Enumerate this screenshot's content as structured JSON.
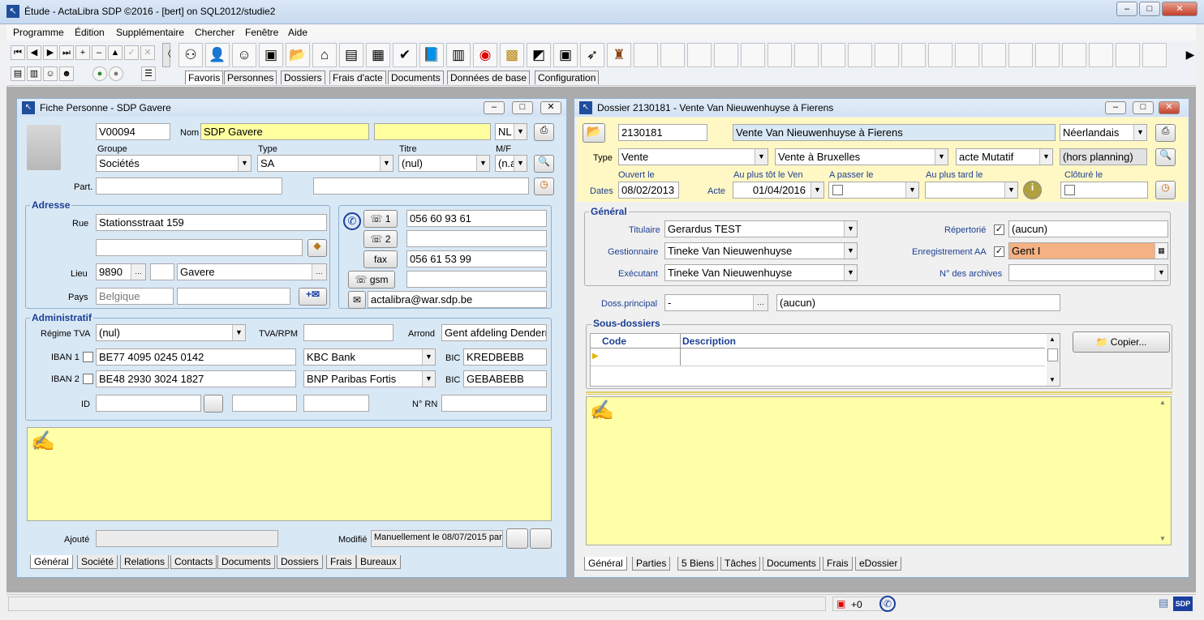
{
  "window": {
    "title": "Étude  - ActaLibra  SDP ©2016 - [bert]  on  SQL2012/studie2"
  },
  "menu": [
    "Programme",
    "Édition",
    "Supplémentaire",
    "Chercher",
    "Fenêtre",
    "Aide"
  ],
  "toolbar_tabs": [
    "Favoris",
    "Personnes",
    "Dossiers",
    "Frais d'acte",
    "Documents",
    "Données de base",
    "Configuration"
  ],
  "person": {
    "title": "Fiche Personne - SDP Gavere",
    "id": "V00094",
    "nom_label": "Nom",
    "nom": "SDP Gavere",
    "lang": "NL",
    "groupe_label": "Groupe",
    "groupe": "Sociétés",
    "type_label": "Type",
    "type": "SA",
    "titre_label": "Titre",
    "titre": "(nul)",
    "mf_label": "M/F",
    "mf": "(n.a",
    "part_label": "Part.",
    "adresse_label": "Adresse",
    "rue_label": "Rue",
    "rue": "Stationsstraat 159",
    "lieu_label": "Lieu",
    "postcode": "9890",
    "lieu": "Gavere",
    "pays_label": "Pays",
    "pays": "Belgique",
    "phone1_label": "1",
    "phone1": "056 60 93 61",
    "phone2_label": "2",
    "fax_label": "fax",
    "fax": "056 61 53 99",
    "gsm_label": "gsm",
    "email": "actalibra@war.sdp.be",
    "admin_label": "Administratif",
    "regime_label": "Régime TVA",
    "regime": "(nul)",
    "tva_label": "TVA/RPM",
    "arrond_label": "Arrond",
    "arrond": "Gent afdeling Denderr",
    "iban1_label": "IBAN 1",
    "iban1": "BE77 4095 0245 0142",
    "bank1": "KBC Bank",
    "bic_label": "BIC",
    "bic1": "KREDBEBB",
    "iban2_label": "IBAN 2",
    "iban2": "BE48 2930 3024 1827",
    "bank2": "BNP Paribas Fortis",
    "bic2": "GEBABEBB",
    "id_label": "ID",
    "rn_label": "N° RN",
    "ajoute_label": "Ajouté",
    "modifie_label": "Modifié",
    "modifie": "Manuellement le 08/07/2015 par [",
    "tabs": [
      "Général",
      "Société",
      "Relations",
      "Contacts",
      "Documents",
      "Dossiers",
      "Frais",
      "Bureaux"
    ]
  },
  "dossier": {
    "title": "Dossier 2130181 - Vente Van Nieuwenhuyse à Fierens",
    "number": "2130181",
    "name": "Vente Van Nieuwenhuyse à Fierens",
    "lang": "Néerlandais",
    "type_label": "Type",
    "type1": "Vente",
    "type2": "Vente à Bruxelles",
    "type3": "acte Mutatif",
    "planning": "(hors planning)",
    "ouvert_label": "Ouvert le",
    "aupl_label": "Au plus tôt le Ven",
    "apasser_label": "A passer le",
    "auplard_label": "Au plus tard le",
    "cloture_label": "Clôturé le",
    "dates_label": "Dates",
    "ouvert": "08/02/2013",
    "acte_label": "Acte",
    "acte": "01/04/2016",
    "general_label": "Général",
    "titulaire_label": "Titulaire",
    "titulaire": "Gerardus TEST",
    "gestionnaire_label": "Gestionnaire",
    "gestionnaire": "Tineke Van Nieuwenhuyse",
    "executant_label": "Exécutant",
    "executant": "Tineke Van Nieuwenhuyse",
    "repertorie_label": "Répertorié",
    "repertorie": "(aucun)",
    "enreg_label": "Enregistrement AA",
    "enreg": "Gent I",
    "archives_label": "N° des archives",
    "principal_label": "Doss.principal",
    "principal": "-",
    "principal_name": "(aucun)",
    "sous_label": "Sous-dossiers",
    "col_code": "Code",
    "col_desc": "Description",
    "copier": "Copier...",
    "tabs": [
      "Général",
      "Parties",
      "5 Biens",
      "Tâches",
      "Documents",
      "Frais",
      "eDossier"
    ]
  },
  "status": {
    "pdf": "+0"
  },
  "colors": {
    "yellow": "#ffffa0",
    "orange": "#f4b183",
    "panel": "#d9e8f5",
    "highlight": "#fff8c4"
  }
}
